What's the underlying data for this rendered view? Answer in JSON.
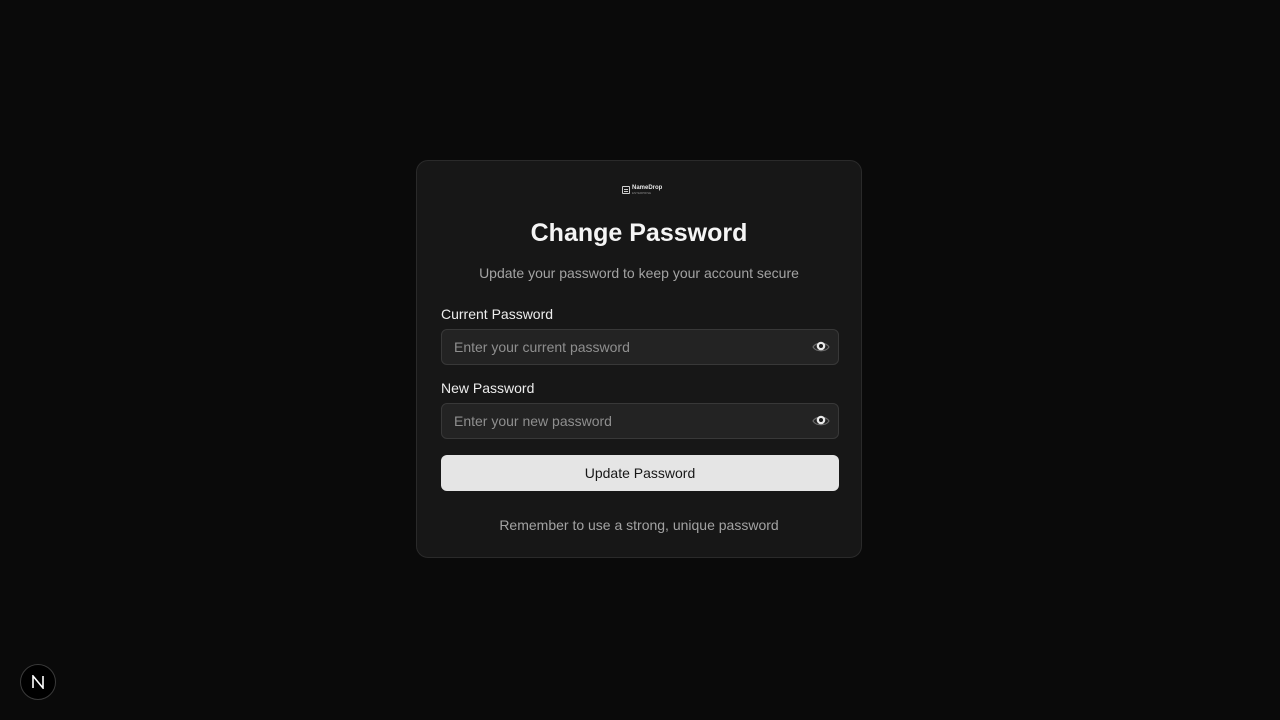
{
  "logo": {
    "name": "NameDrop",
    "tagline": "ENTERPRISE",
    "icon": "document-logo-icon"
  },
  "form": {
    "title": "Change Password",
    "subtitle": "Update your password to keep your account secure",
    "current_password": {
      "label": "Current Password",
      "value": "",
      "placeholder": "Enter your current password",
      "toggle_icon": "eye-icon"
    },
    "new_password": {
      "label": "New Password",
      "value": "",
      "placeholder": "Enter your new password",
      "toggle_icon": "eye-icon"
    },
    "submit_label": "Update Password",
    "footnote": "Remember to use a strong, unique password"
  },
  "dev_badge": {
    "letter": "N",
    "icon": "nextjs-dev-indicator-icon"
  },
  "colors": {
    "background": "#0a0a0a",
    "card": "#171717",
    "button": "#e5e5e5"
  }
}
